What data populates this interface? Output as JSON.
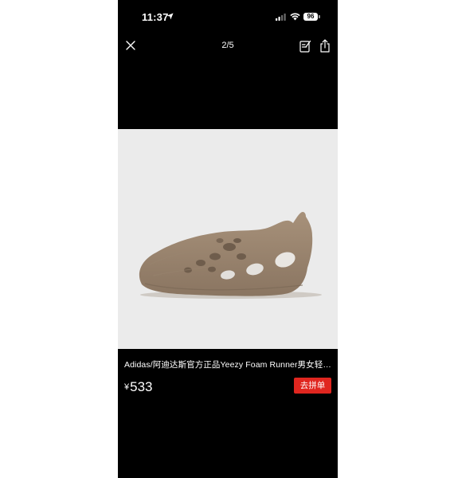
{
  "status_bar": {
    "time": "11:37",
    "battery": "96"
  },
  "nav": {
    "counter": "2/5"
  },
  "product": {
    "title": "Adidas/阿迪达斯官方正品Yeezy Foam Runner男女轻便凉…",
    "currency_symbol": "¥",
    "price": "533",
    "buy_button_label": "去拼单"
  },
  "colors": {
    "background": "#000000",
    "image_background": "#ebebeb",
    "accent": "#e0261f"
  }
}
